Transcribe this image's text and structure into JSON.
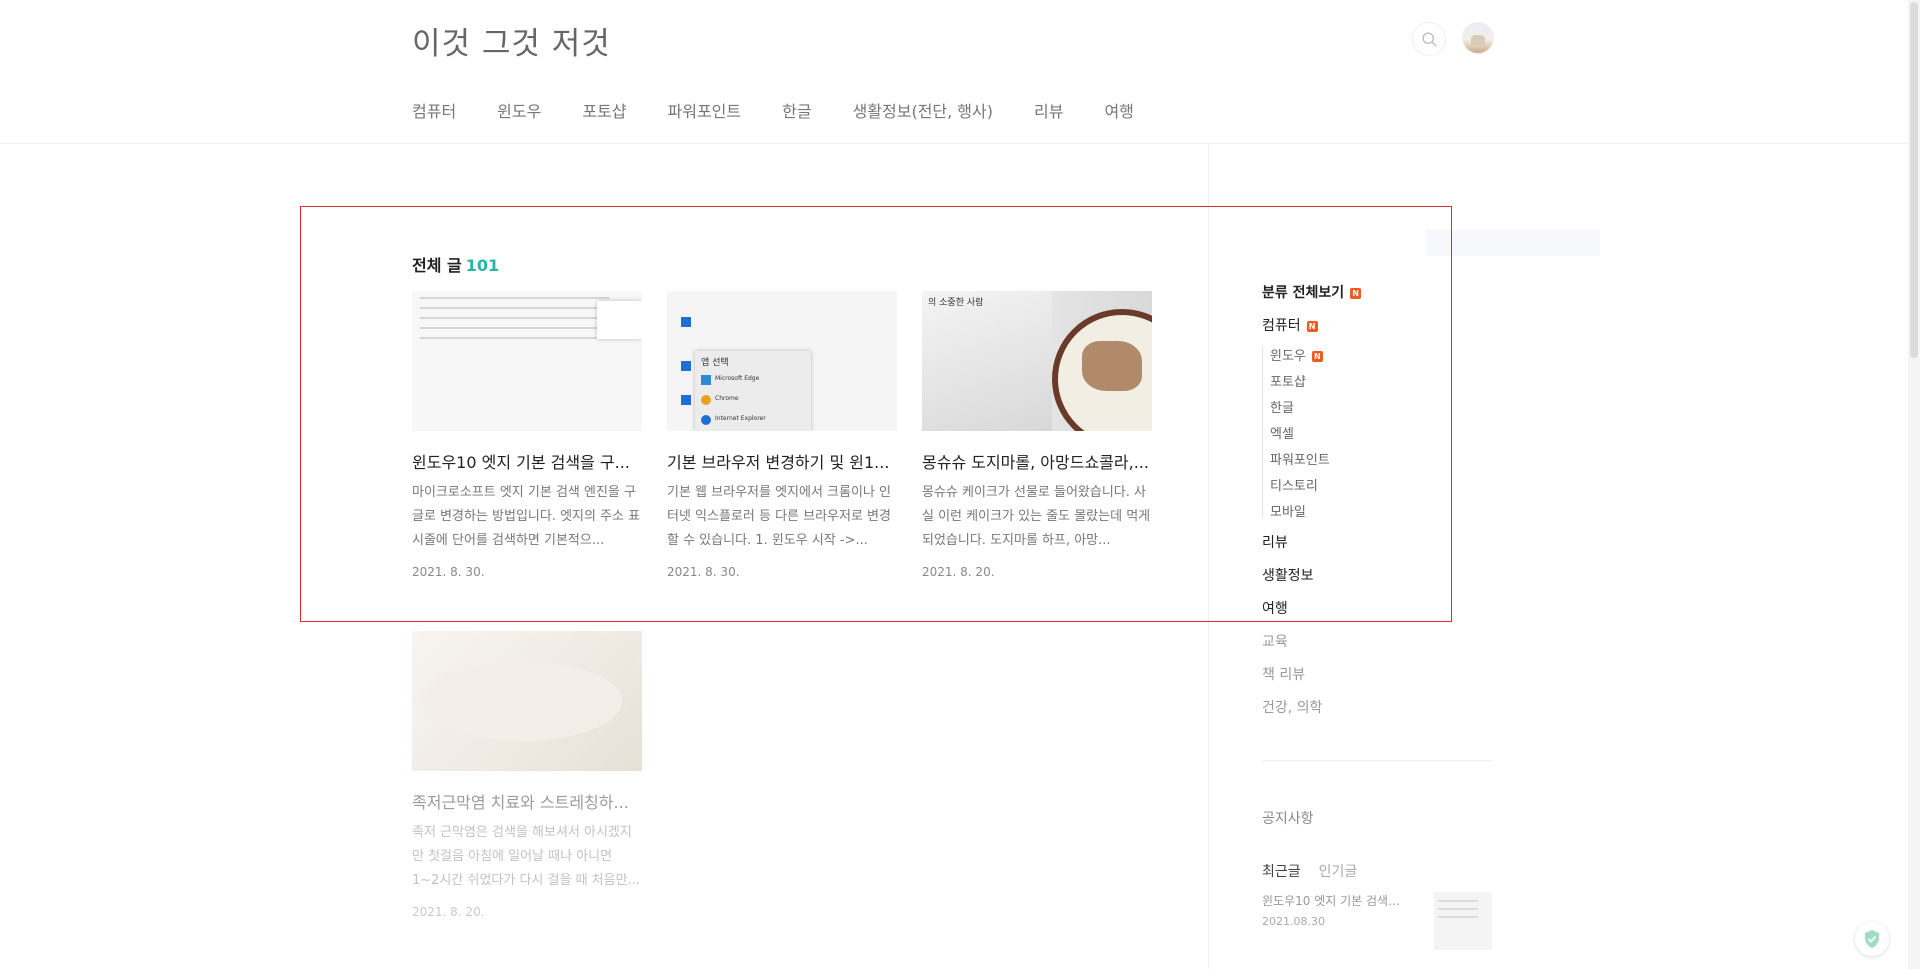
{
  "site": {
    "title": "이것 그것 저것"
  },
  "nav": [
    "컴퓨터",
    "윈도우",
    "포토샵",
    "파워포인트",
    "한글",
    "생활정보(전단, 행사)",
    "리뷰",
    "여행"
  ],
  "section": {
    "title": "전체 글",
    "count": "101"
  },
  "posts": [
    {
      "title": "윈도우10 엣지 기본 검색을 구...",
      "excerpt": "마이크로소프트 엣지 기본 검색 엔진을 구글로 변경하는 방법입니다. 엣지의 주소 표시줄에 단어를 검색하면 기본적으...",
      "date": "2021. 8. 30."
    },
    {
      "title": "기본 브라우저 변경하기 및 윈1...",
      "excerpt": "기본 웹 브라우저를 엣지에서 크롬이나 인터넷 익스플로러 등 다른 브라우저로 변경할 수 있습니다. 1. 윈도우 시작 ->...",
      "date": "2021. 8. 30."
    },
    {
      "title": "몽슈슈 도지마롤, 아망드쇼콜라,...",
      "excerpt": "몽슈슈 케이크가 선물로 들어왔습니다. 사실 이런 케이크가 있는 줄도 몰랐는데 먹게 되었습니다. 도지마롤 하프, 아망...",
      "date": "2021. 8. 20."
    },
    {
      "title": "족저근막염 치료와 스트레칭하...",
      "excerpt": "족저 근막염은 검색을 해보셔서 아시겠지만 첫걸음 아침에 일어날 때나 아니면 1~2시간 쉬었다가 다시 걸을 때 처음만...",
      "date": "2021. 8. 20."
    }
  ],
  "thumbs": {
    "t2_menu_title": "앱 선택",
    "t2_items": [
      "Microsoft Edge",
      "Chrome",
      "Internet Explorer"
    ],
    "t3_text": "의 소중한 사람"
  },
  "sidebar": {
    "search_placeholder": "",
    "categories_all": "분류 전체보기",
    "computer": "컴퓨터",
    "sub": [
      "윈도우",
      "포토샵",
      "한글",
      "엑셀",
      "파워포인트",
      "티스토리",
      "모바일"
    ],
    "top": [
      "리뷰",
      "생활정보",
      "여행",
      "교육",
      "책 리뷰",
      "건강, 의학"
    ],
    "new_badge": "N",
    "notice": "공지사항",
    "tabs": {
      "recent": "최근글",
      "popular": "인기글"
    },
    "recent_item": {
      "title": "윈도우10 엣지 기본 검색…",
      "date": "2021.08.30"
    }
  },
  "colors": {
    "accent": "#27b5a5",
    "badge": "#f15a22",
    "highlight": "#e12b2b"
  }
}
